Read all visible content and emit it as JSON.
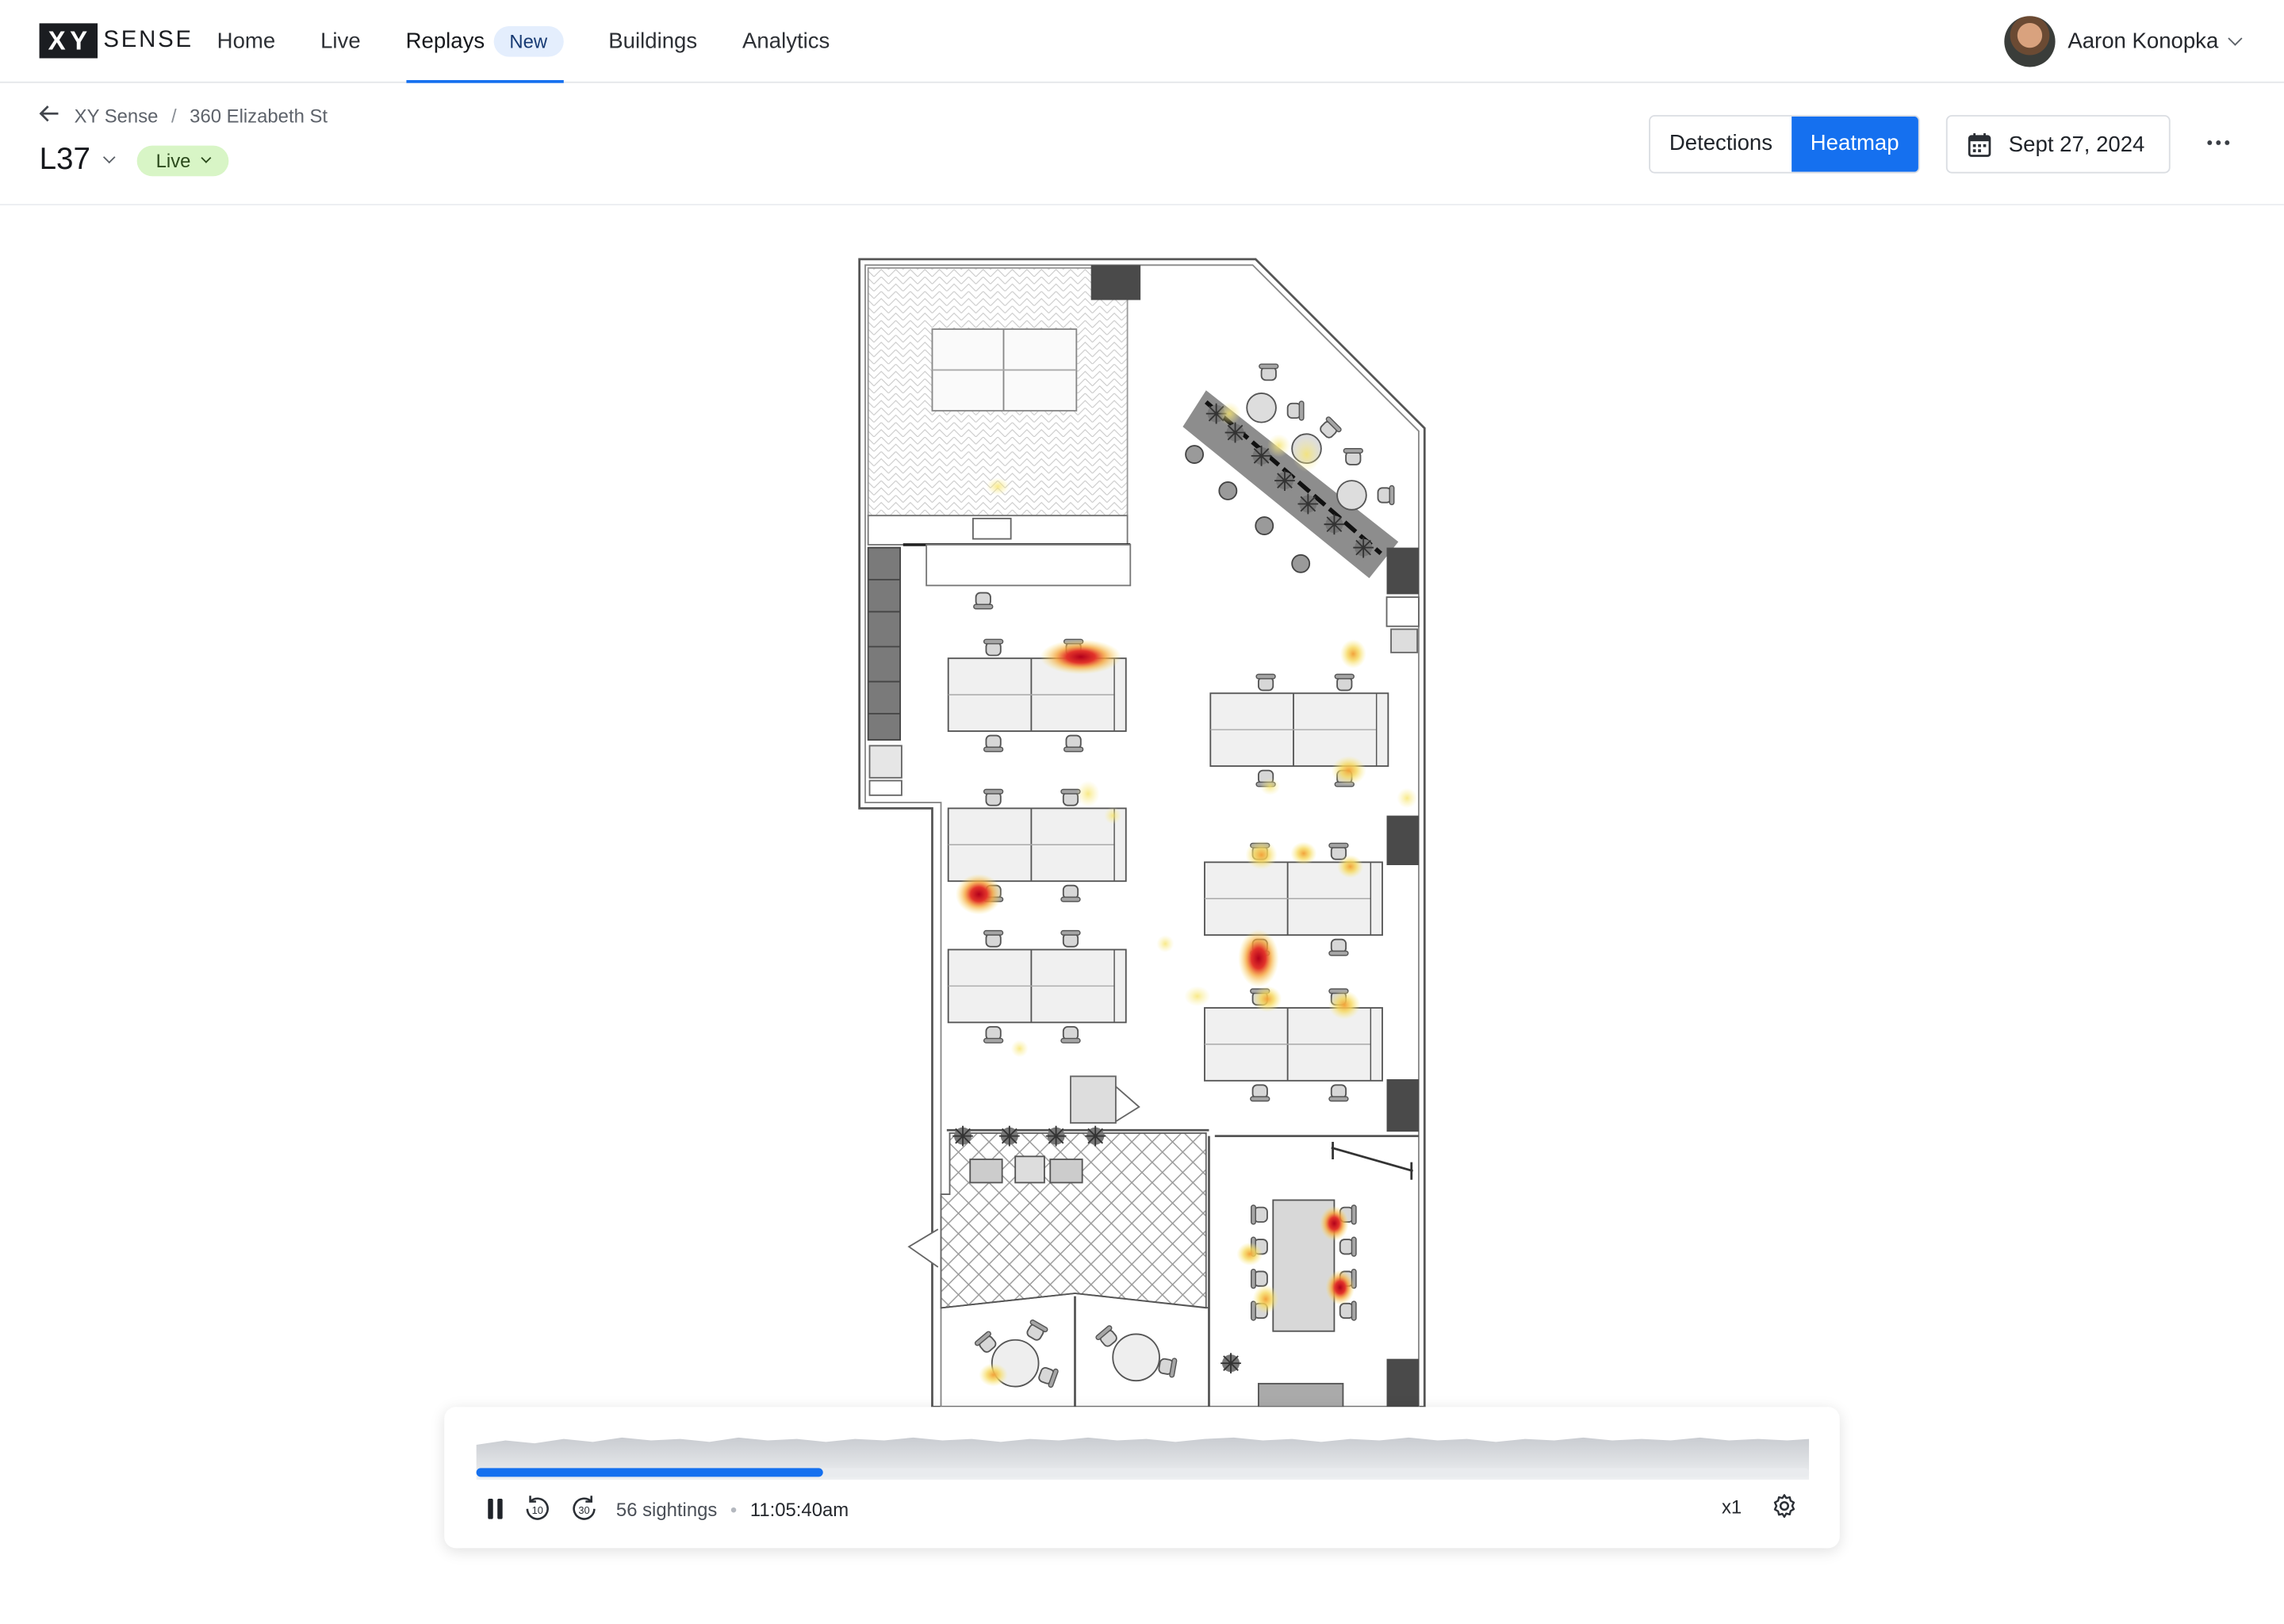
{
  "nav": {
    "logo_mark": "XY",
    "logo_text": "SENSE",
    "items": [
      {
        "label": "Home"
      },
      {
        "label": "Live"
      },
      {
        "label": "Replays",
        "badge": "New"
      },
      {
        "label": "Buildings"
      },
      {
        "label": "Analytics"
      }
    ],
    "user_name": "Aaron Konopka"
  },
  "header": {
    "breadcrumb": [
      "XY Sense",
      "360 Elizabeth St"
    ],
    "floor": "L37",
    "live_label": "Live",
    "tabs": [
      {
        "label": "Detections"
      },
      {
        "label": "Heatmap"
      }
    ],
    "active_tab": "Heatmap",
    "date": "Sept 27, 2024"
  },
  "player": {
    "progress": 0.26,
    "sightings": "56 sightings",
    "time": "11:05:40am",
    "speed": "x1"
  },
  "colors": {
    "accent": "#1570ef",
    "live_badge": "#d8f5c6",
    "heat_hot": "#c40f1e",
    "heat_warm": "#f7e36a"
  },
  "icons": [
    "back-arrow-icon",
    "calendar-icon",
    "more-icon",
    "pause-icon",
    "rewind-10-icon",
    "forward-30-icon",
    "settings-icon",
    "chevron-down-icon"
  ]
}
